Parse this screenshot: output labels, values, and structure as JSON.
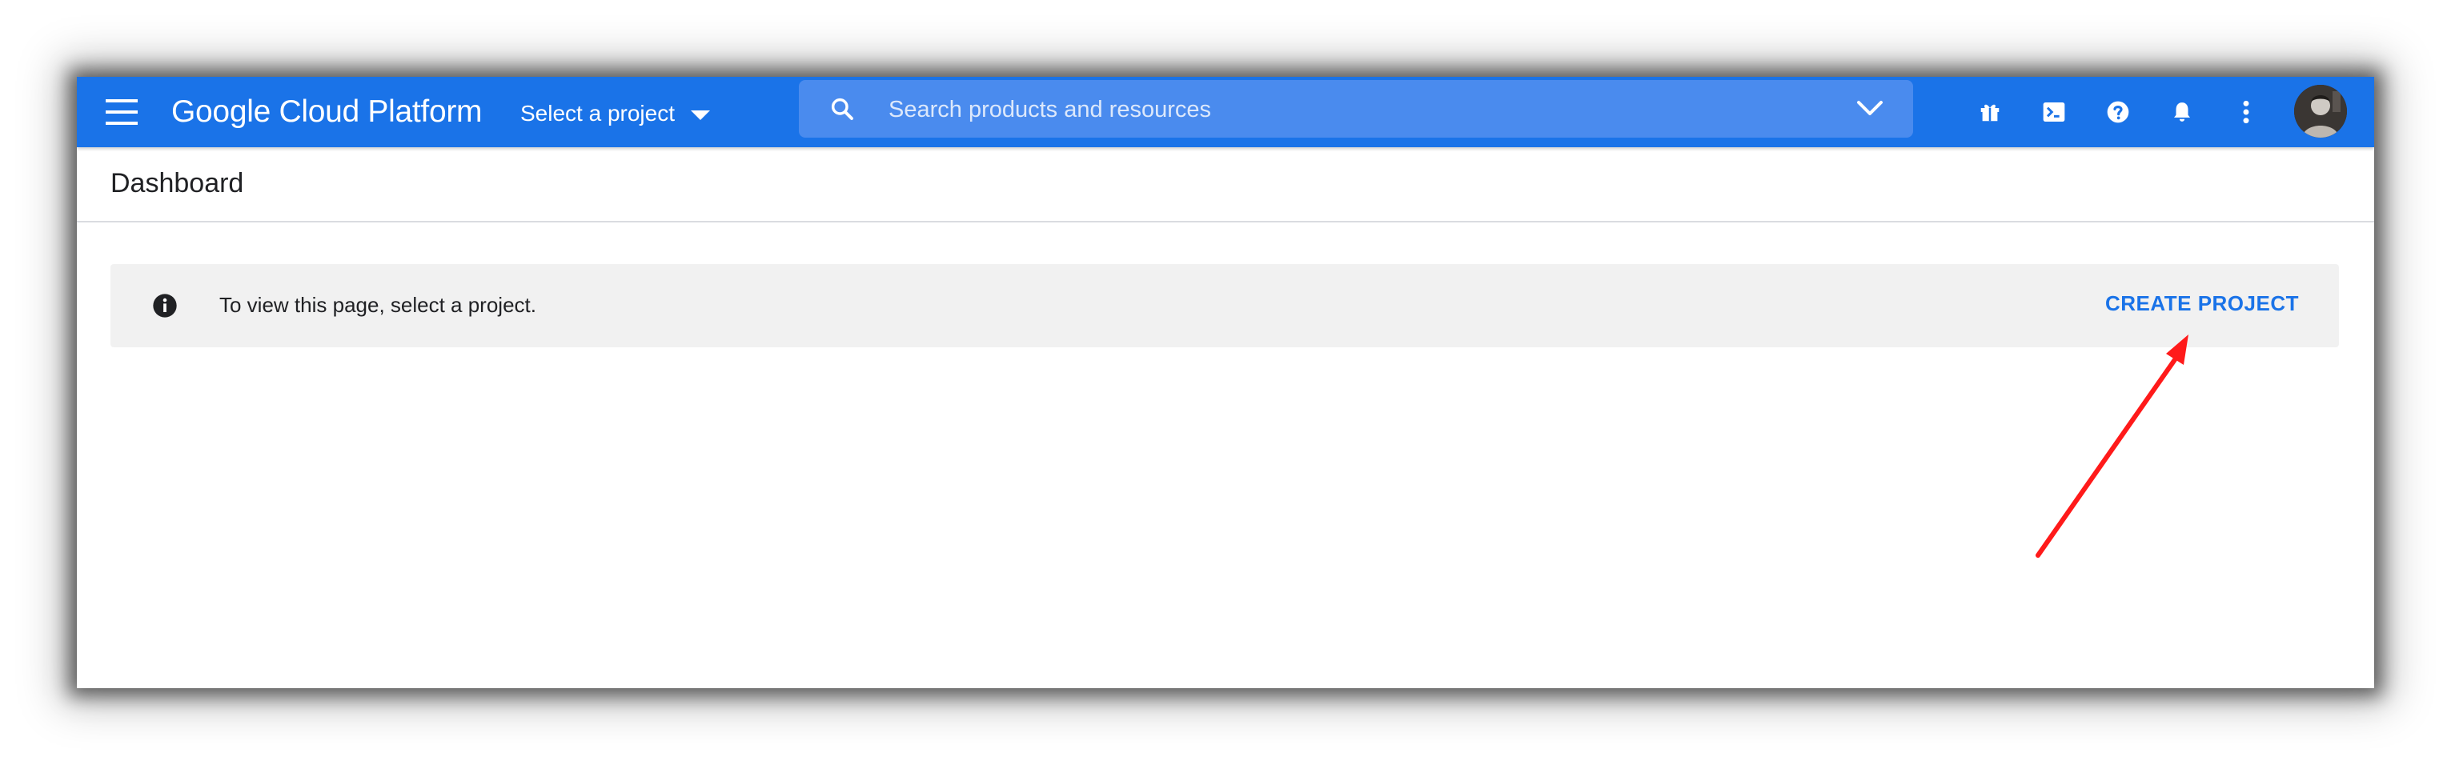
{
  "topbar": {
    "menu_icon": "hamburger-menu-icon",
    "brand": "Google Cloud Platform",
    "project_selector": "Select a project",
    "search": {
      "placeholder": "Search products and resources",
      "value": ""
    },
    "actions": [
      "gift-icon",
      "terminal-icon",
      "help-icon",
      "notifications-icon",
      "more-vert-icon"
    ]
  },
  "header": {
    "title": "Dashboard"
  },
  "notice": {
    "icon": "info-icon",
    "message": "To view this page, select a project.",
    "action_label": "CREATE PROJECT"
  },
  "annotation": {
    "arrow_color": "#ff1a1a"
  },
  "colors": {
    "topbar": "#1a73e8",
    "search_bg": "#4a8bee",
    "link": "#1a73e8",
    "notice_bg": "#f1f1f1"
  }
}
